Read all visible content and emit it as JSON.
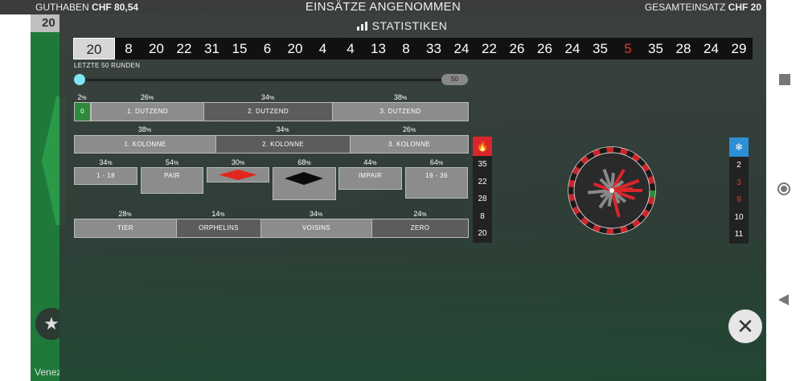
{
  "topbar": {
    "balance_label": "GUTHABEN",
    "balance_value": "CHF 80,54",
    "title": "EINSÄTZE ANGENOMMEN",
    "total_bet_label": "GESAMTEINSATZ",
    "total_bet_value": "CHF 20"
  },
  "game": {
    "last_number_tag": "20",
    "venue_text": "Venez"
  },
  "stats": {
    "title": "STATISTIKEN",
    "recent_numbers": [
      "20",
      "8",
      "20",
      "22",
      "31",
      "15",
      "6",
      "20",
      "4",
      "4",
      "13",
      "8",
      "33",
      "24",
      "22",
      "26",
      "26",
      "24",
      "35",
      "5",
      "35",
      "28",
      "24",
      "29"
    ],
    "red_numbers": [
      "5"
    ],
    "rounds_label": "LETZTE 50 RUNDEN",
    "slider_value": "50",
    "dozens": {
      "zero_pct": "2",
      "zero_label": "0",
      "d1_pct": "26",
      "d1_label": "1. DUTZEND",
      "d2_pct": "34",
      "d2_label": "2. DUTZEND",
      "d3_pct": "38",
      "d3_label": "3. DUTZEND"
    },
    "columns": {
      "c1_pct": "38",
      "c1_label": "1. KOLONNE",
      "c2_pct": "34",
      "c2_label": "2. KOLONNE",
      "c3_pct": "26",
      "c3_label": "3. KOLONNE"
    },
    "even_chances": {
      "low_pct": "34",
      "low_label": "1 - 18",
      "even_pct": "54",
      "even_label": "PAIR",
      "red_pct": "30",
      "black_pct": "68",
      "odd_pct": "44",
      "odd_label": "IMPAIR",
      "high_pct": "64",
      "high_label": "19 - 36"
    },
    "sectors": {
      "tier_pct": "28",
      "tier_label": "TIER",
      "orph_pct": "14",
      "orph_label": "ORPHELINS",
      "voisins_pct": "34",
      "voisins_label": "VOISINS",
      "zero_pct": "24",
      "zero_label": "ZERO"
    },
    "pct_sign": "%",
    "hot_numbers": [
      "35",
      "22",
      "28",
      "8",
      "20"
    ],
    "cold_numbers": [
      "2",
      "3",
      "9",
      "10",
      "11"
    ],
    "cold_red": [
      "3",
      "9"
    ],
    "colors": {
      "hot": "#d9262b",
      "cold": "#2d8fd5",
      "red": "#e23b2b"
    },
    "icons": {
      "hot": "fire-icon",
      "cold": "snowflake-icon",
      "close": "close-icon",
      "favorite": "star-icon",
      "stats": "bar-chart-icon"
    }
  }
}
